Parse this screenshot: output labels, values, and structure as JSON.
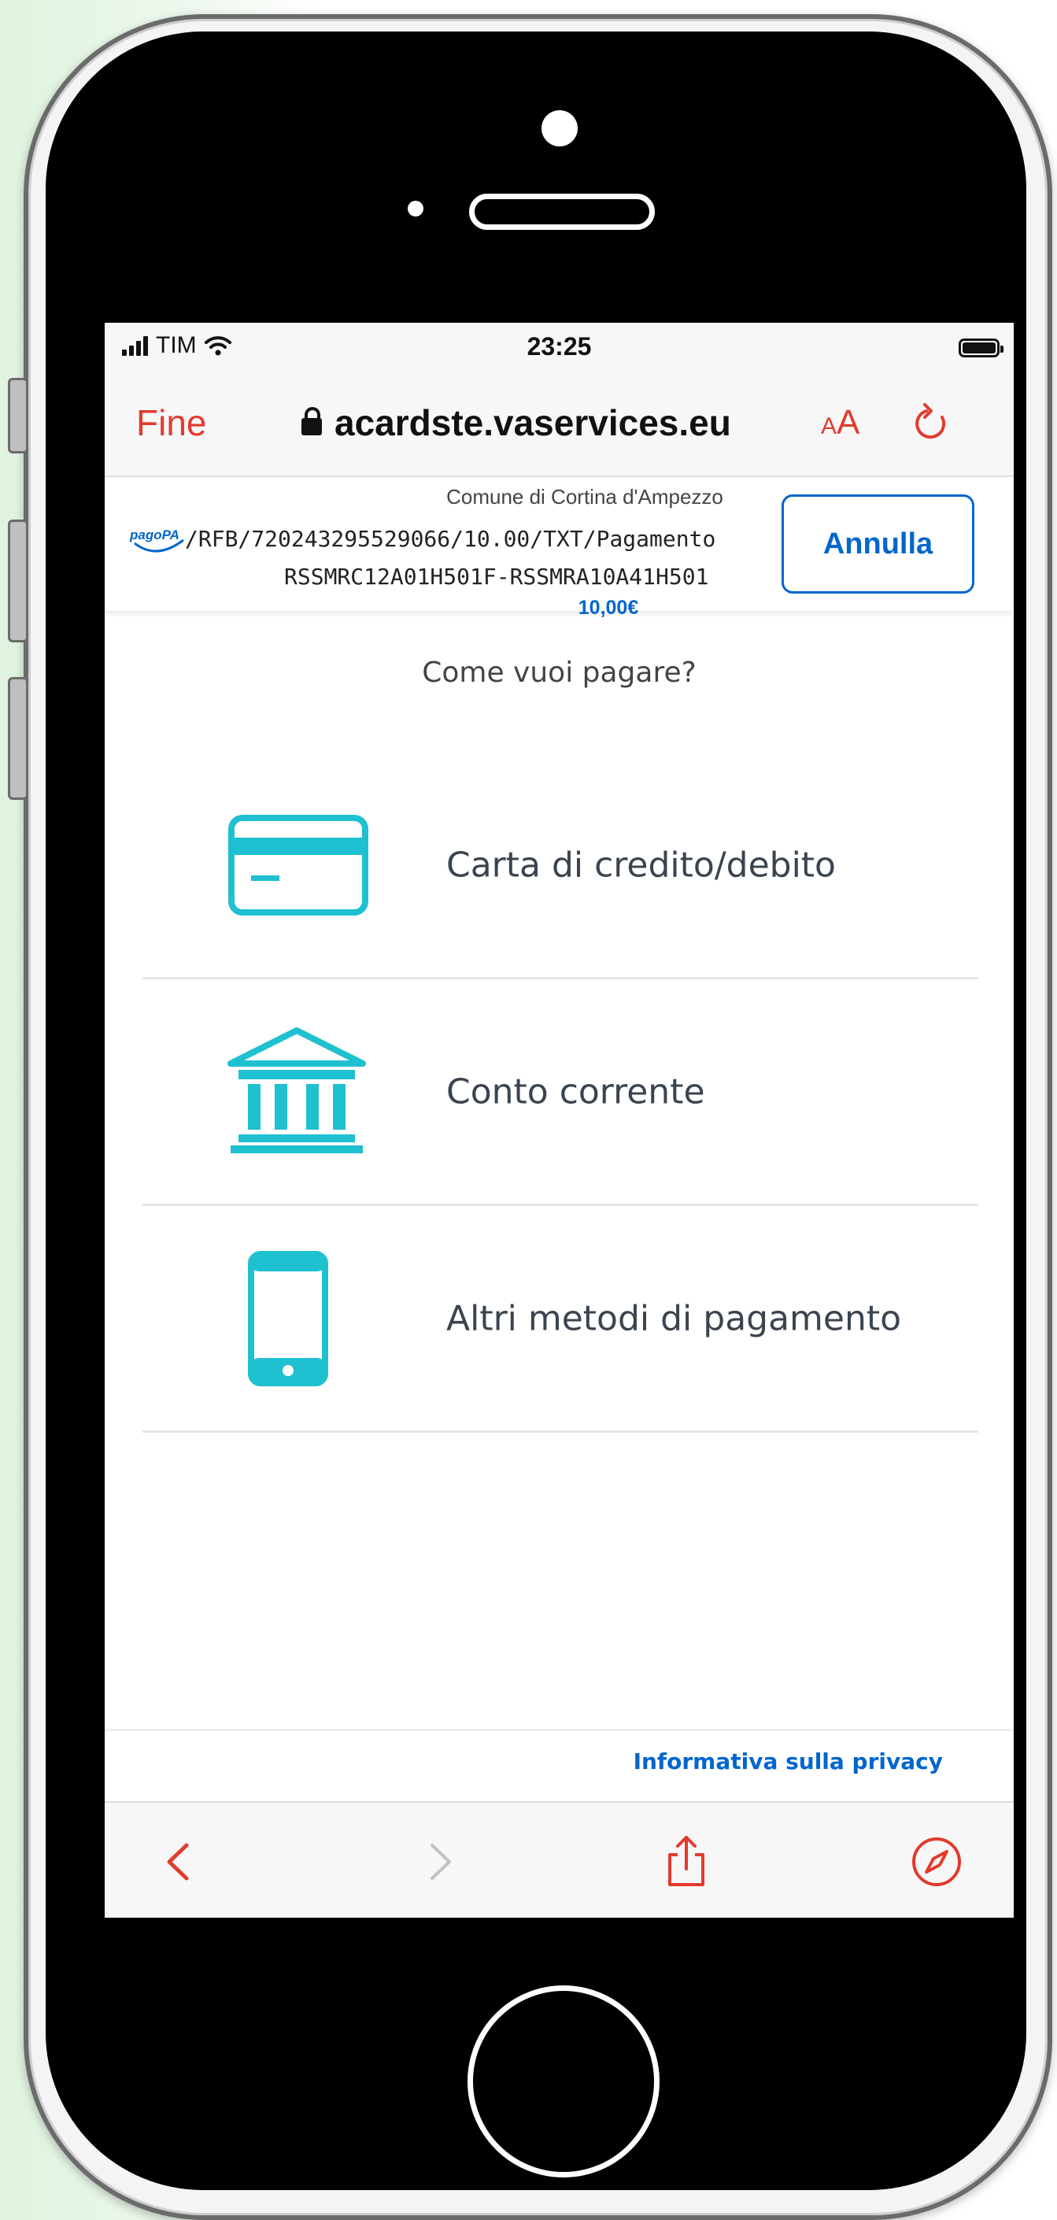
{
  "status_bar": {
    "carrier": "TIM",
    "time": "23:25"
  },
  "browser": {
    "done_label": "Fine",
    "url": "acardste.vaservices.eu",
    "text_size_small": "A",
    "text_size_big": "A"
  },
  "payment": {
    "logo_text": "pagoPA",
    "creditor": "Comune di Cortina d'Ampezzo",
    "notice_line1": "/RFB/720243295529066/10.00/TXT/Pagamento",
    "notice_line2": "RSSMRC12A01H501F-RSSMRA10A41H501",
    "amount": "10,00€",
    "cancel_label": "Annulla"
  },
  "question": "Come vuoi pagare?",
  "methods": [
    {
      "label": "Carta di credito/debito",
      "icon": "credit-card-icon"
    },
    {
      "label": "Conto corrente",
      "icon": "bank-icon"
    },
    {
      "label": "Altri metodi di pagamento",
      "icon": "smartphone-icon"
    }
  ],
  "footer": {
    "privacy_link": "Informativa sulla privacy"
  },
  "toolbar": {
    "icons": [
      "back-icon",
      "forward-icon",
      "share-icon",
      "compass-icon"
    ]
  },
  "colors": {
    "accent_red": "#e23b2e",
    "link_blue": "#0066cc",
    "icon_teal": "#1fc0d0"
  }
}
